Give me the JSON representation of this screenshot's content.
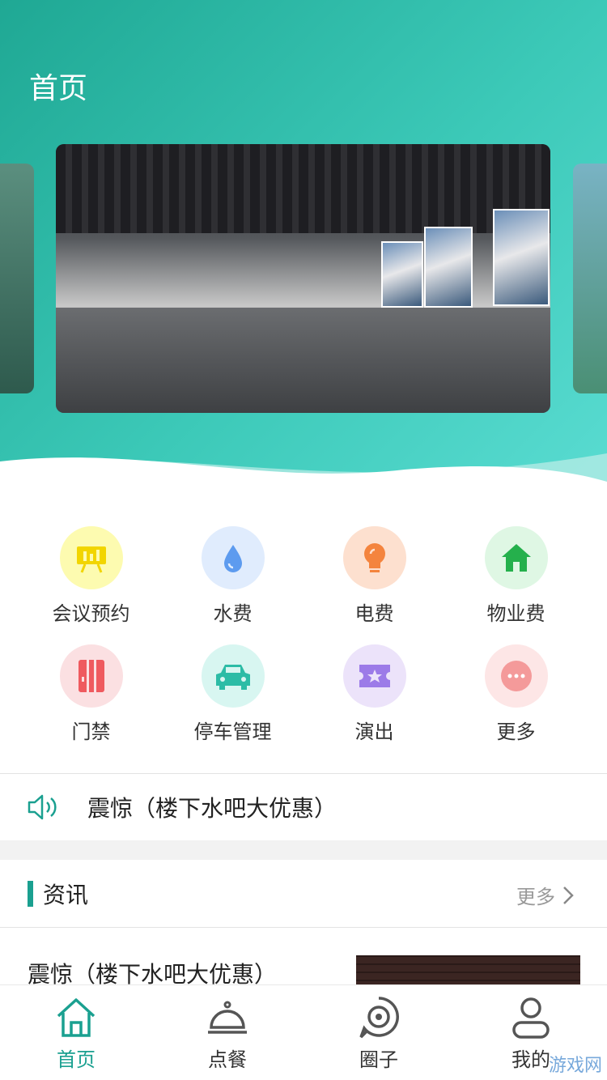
{
  "header": {
    "title": "首页"
  },
  "features": [
    {
      "label": "会议预约",
      "icon": "presentation-board-icon",
      "bg": "#fdfbb0",
      "fg": "#f2d500"
    },
    {
      "label": "水费",
      "icon": "water-drop-icon",
      "bg": "#e0ecfd",
      "fg": "#5d9bef"
    },
    {
      "label": "电费",
      "icon": "light-bulb-icon",
      "bg": "#fde0cf",
      "fg": "#f4843e"
    },
    {
      "label": "物业费",
      "icon": "house-icon",
      "bg": "#dff7e4",
      "fg": "#25b04c"
    },
    {
      "label": "门禁",
      "icon": "door-access-icon",
      "bg": "#fbe0e2",
      "fg": "#ef5a5f"
    },
    {
      "label": "停车管理",
      "icon": "car-icon",
      "bg": "#d8f6f1",
      "fg": "#2cbca6"
    },
    {
      "label": "演出",
      "icon": "ticket-star-icon",
      "bg": "#ece3fa",
      "fg": "#9c7be8"
    },
    {
      "label": "更多",
      "icon": "more-dots-icon",
      "bg": "#fde6e6",
      "fg": "#f49a9a"
    }
  ],
  "notice": {
    "text": "震惊（楼下水吧大优惠）"
  },
  "news": {
    "title": "资讯",
    "more_label": "更多",
    "items": [
      {
        "title": "震惊（楼下水吧大优惠）"
      }
    ]
  },
  "tabs": [
    {
      "label": "首页",
      "icon": "home-icon",
      "active": true
    },
    {
      "label": "点餐",
      "icon": "food-cloche-icon",
      "active": false
    },
    {
      "label": "圈子",
      "icon": "circle-chat-icon",
      "active": false
    },
    {
      "label": "我的",
      "icon": "user-icon",
      "active": false
    }
  ],
  "colors": {
    "accent": "#1aa090",
    "hero_start": "#1fa894",
    "hero_end": "#5adcd2"
  },
  "watermark": {
    "text": "游戏网"
  }
}
